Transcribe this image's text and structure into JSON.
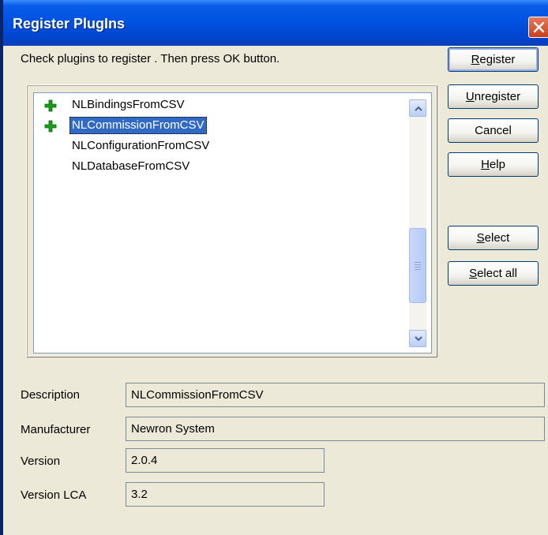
{
  "window": {
    "title": "Register PlugIns"
  },
  "instruction": "Check plugins to register . Then press OK button.",
  "plugins": [
    {
      "name": "NLBindingsFromCSV",
      "has_icon": true,
      "selected": false
    },
    {
      "name": "NLCommissionFromCSV",
      "has_icon": true,
      "selected": true
    },
    {
      "name": "NLConfigurationFromCSV",
      "has_icon": false,
      "selected": false
    },
    {
      "name": "NLDatabaseFromCSV",
      "has_icon": false,
      "selected": false
    }
  ],
  "buttons": {
    "register": {
      "mnemonic": "R",
      "rest": "egister"
    },
    "unregister": {
      "mnemonic": "U",
      "rest": "nregister"
    },
    "cancel": {
      "label": "Cancel"
    },
    "help": {
      "mnemonic": "H",
      "rest": "elp"
    },
    "select": {
      "mnemonic": "S",
      "rest": "elect"
    },
    "select_all": {
      "mnemonic": "S",
      "rest": "elect all"
    }
  },
  "details": {
    "description": {
      "label": "Description",
      "value": "NLCommissionFromCSV"
    },
    "manufacturer": {
      "label": "Manufacturer",
      "value": "Newron System"
    },
    "version": {
      "label": "Version",
      "value": "2.0.4"
    },
    "version_lca": {
      "label": "Version LCA",
      "value": "3.2"
    }
  },
  "colors": {
    "titlebar": "#0054e3",
    "selection": "#316ac5",
    "plus_icon": "#1a9b1a",
    "dialog_bg": "#ece9d8"
  }
}
